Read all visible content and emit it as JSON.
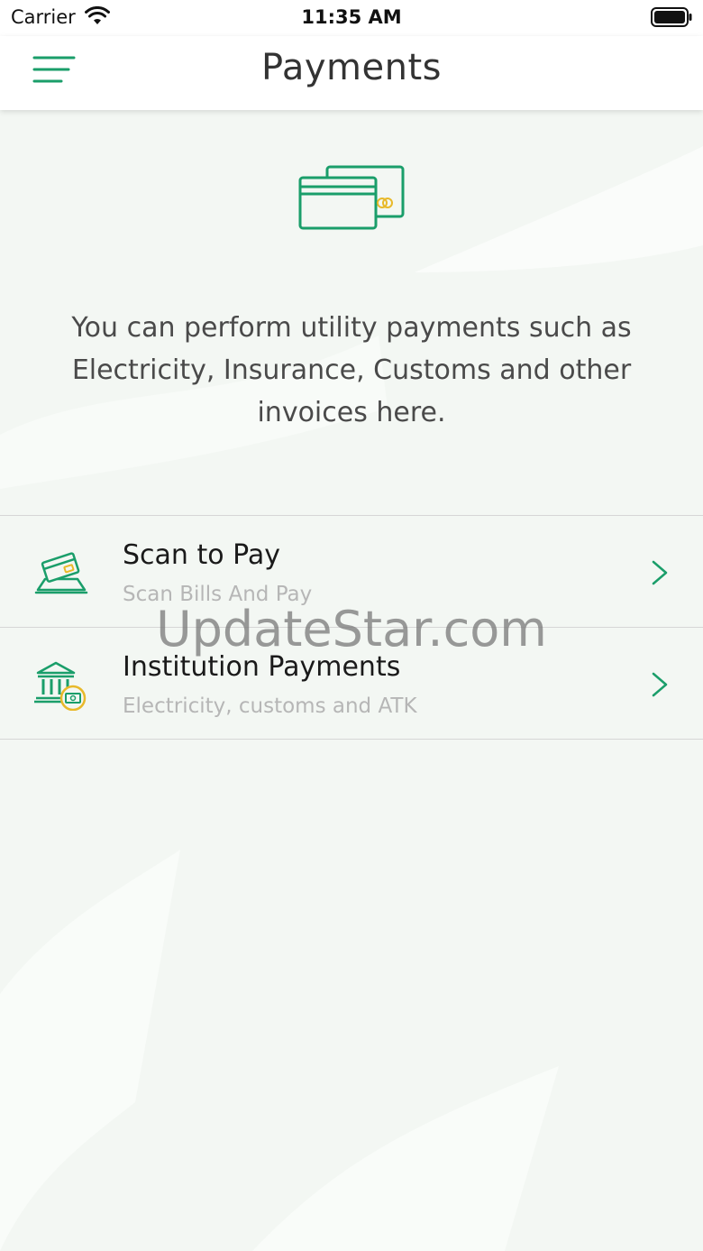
{
  "status_bar": {
    "carrier": "Carrier",
    "time": "11:35 AM"
  },
  "nav": {
    "title": "Payments",
    "menu_icon": "hamburger-menu-icon"
  },
  "hero": {
    "icon": "credit-cards-icon",
    "text": "You can perform utility payments such as Electricity, Insurance, Customs and other invoices here."
  },
  "items": [
    {
      "title": "Scan to Pay",
      "subtitle": "Scan Bills And Pay",
      "icon": "scan-card-icon"
    },
    {
      "title": "Institution Payments",
      "subtitle": "Electricity, customs and ATK",
      "icon": "institution-icon"
    }
  ],
  "watermark": "UpdateStar.com",
  "colors": {
    "accent": "#1a9e6a",
    "coin": "#e8b92a",
    "background": "#f3f7f3"
  }
}
